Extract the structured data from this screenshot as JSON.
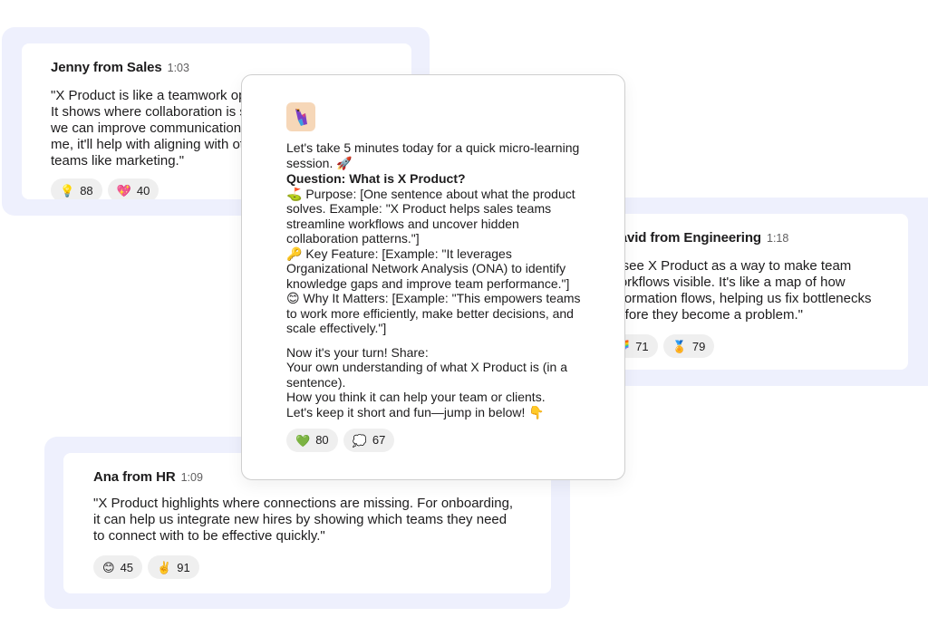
{
  "cards": {
    "jenny": {
      "name": "Jenny from Sales",
      "time": "1:03",
      "text": "\"X Product is like a teamwork optimizer. It shows where collaboration is stuck so we can improve communication. For me, it'll help with aligning with other teams like marketing.\"",
      "reactions": [
        {
          "emoji": "💡",
          "icon": "lightbulb-icon",
          "count": "88"
        },
        {
          "emoji": "💖",
          "icon": "sparkling-heart-icon",
          "count": "40"
        }
      ]
    },
    "david": {
      "name": "David from Engineering",
      "time": "1:18",
      "text": "\"I see X Product as a way to make team workflows visible. It's like a map of how information flows, helping us fix bottlenecks before they become a problem.\"",
      "reactions": [
        {
          "emoji": "🌈",
          "icon": "rainbow-icon",
          "count": "71"
        },
        {
          "emoji": "🏅",
          "icon": "medal-icon",
          "count": "79"
        }
      ]
    },
    "ana": {
      "name": "Ana from HR",
      "time": "1:09",
      "text": "\"X Product highlights where connections are missing. For onboarding, it can help us integrate new hires by showing which teams they need to connect with to be effective quickly.\"",
      "reactions": [
        {
          "emoji": "😊",
          "icon": "smile-icon",
          "count": "45"
        },
        {
          "emoji": "✌️",
          "icon": "victory-hand-icon",
          "count": "91"
        }
      ]
    }
  },
  "post": {
    "intro": "Let's take 5 minutes today for a quick micro-learning session. 🚀",
    "question": "Question: What is X Product?",
    "purpose": "⛳ Purpose: [One sentence about what the product solves. Example: \"X Product helps sales teams streamline workflows and uncover hidden collaboration patterns.\"]",
    "key_feature": "🔑 Key Feature: [Example: \"It leverages Organizational Network Analysis (ONA) to identify knowledge gaps and improve team performance.\"]",
    "why": "😊 Why It Matters: [Example: \"This empowers teams to work more efficiently, make better decisions, and scale effectively.\"]",
    "share_title": "Now it's your turn! Share:",
    "share_1": "Your own understanding of what X Product is (in a sentence).",
    "share_2": "How you think it can help your team or clients.",
    "share_3": "Let's keep it short and fun—jump in below! 👇",
    "reactions": [
      {
        "emoji": "💚",
        "icon": "green-heart-icon",
        "count": "80"
      },
      {
        "emoji": "💭",
        "icon": "thought-bubble-icon",
        "count": "67"
      }
    ]
  }
}
